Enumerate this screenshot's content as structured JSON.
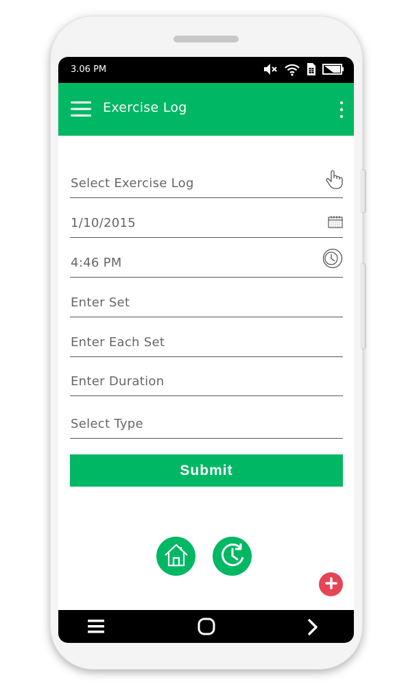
{
  "status_bar": {
    "time": "3.06 PM",
    "icons": [
      "mute-icon",
      "wifi-icon",
      "sim-icon",
      "battery-icon"
    ]
  },
  "app_bar": {
    "title": "Exercise Log",
    "menu_icon": "hamburger-menu-icon",
    "more_icon": "more-vert-icon",
    "color": "#00b764"
  },
  "form": {
    "select_exercise_log": "Select Exercise Log",
    "date": "1/10/2015",
    "time": "4:46 PM",
    "set_placeholder": "Enter Set",
    "each_set_placeholder": "Enter Each Set",
    "duration_placeholder": "Enter Duration",
    "type_placeholder": "Select Type",
    "submit_label": "Submit"
  },
  "actions": {
    "home_icon": "home-icon",
    "history_icon": "history-icon",
    "add_icon": "add-icon",
    "add_color": "#e64556"
  },
  "nav_bar": {
    "icons": [
      "recent-apps-icon",
      "home-button-icon",
      "back-icon"
    ]
  }
}
